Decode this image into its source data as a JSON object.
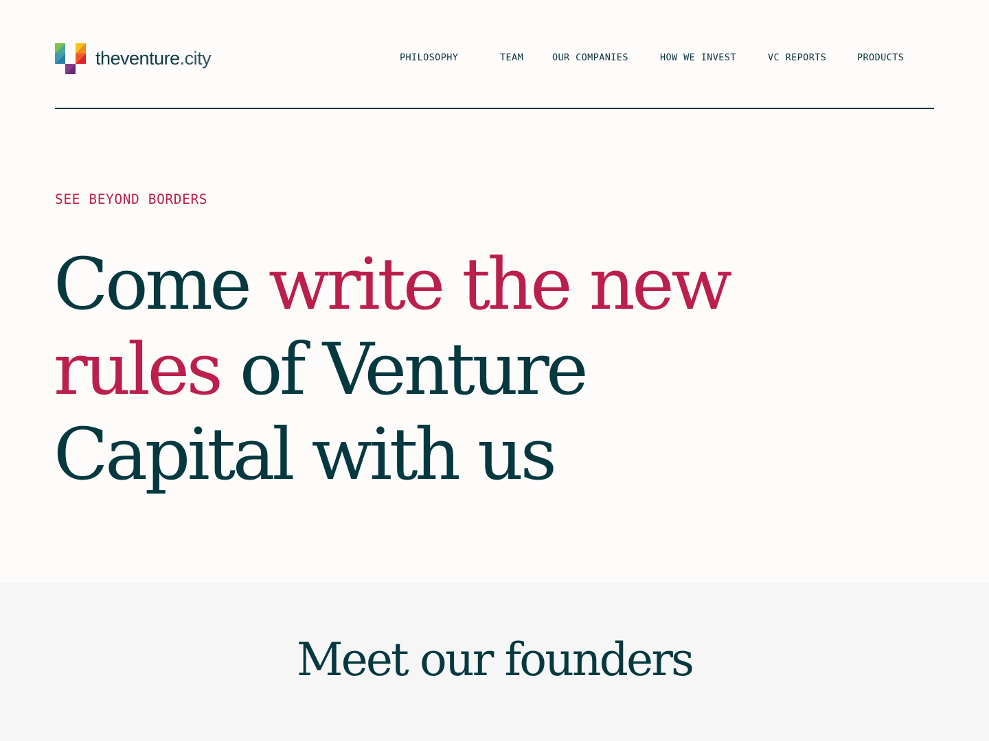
{
  "brand": {
    "logo_text_bold": "theventure",
    "logo_text_light": ".city",
    "logo_icon": "multicolor-pixel-icon"
  },
  "nav": {
    "items": [
      {
        "label": "PHILOSOPHY"
      },
      {
        "label": "TEAM"
      },
      {
        "label": "OUR COMPANIES"
      },
      {
        "label": "HOW WE INVEST"
      },
      {
        "label": "VC REPORTS"
      },
      {
        "label": "PRODUCTS"
      }
    ]
  },
  "hero": {
    "eyebrow": "SEE BEYOND BORDERS",
    "title_part1": "Come ",
    "title_part2": "write the new",
    "title_part3": "rules",
    "title_part4": " of Venture",
    "title_part5": "Capital with us"
  },
  "founders": {
    "title": "Meet our founders"
  },
  "colors": {
    "background": "#fefbfb",
    "primary_text": "#06393f",
    "accent": "#bb1f4b",
    "section_bg": "#f6f6f6",
    "divider": "#0c343d"
  }
}
